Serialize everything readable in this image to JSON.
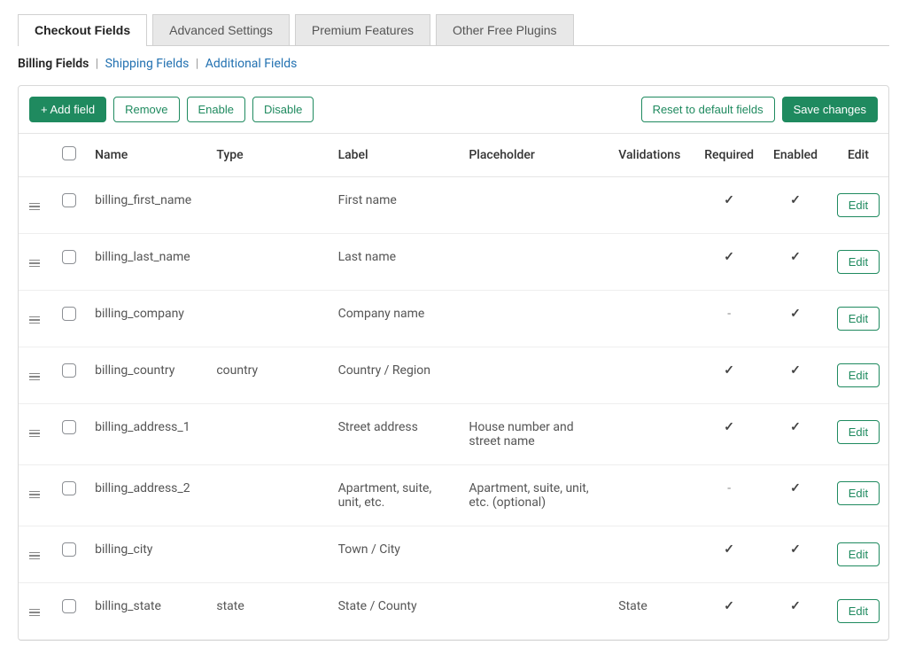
{
  "tabs": {
    "checkout_fields": "Checkout Fields",
    "advanced_settings": "Advanced Settings",
    "premium_features": "Premium Features",
    "other_free_plugins": "Other Free Plugins"
  },
  "subnav": {
    "billing": "Billing Fields",
    "shipping": "Shipping Fields",
    "additional": "Additional Fields"
  },
  "toolbar": {
    "add_field": "+ Add field",
    "remove": "Remove",
    "enable": "Enable",
    "disable": "Disable",
    "reset": "Reset to default fields",
    "save": "Save changes"
  },
  "columns": {
    "name": "Name",
    "type": "Type",
    "label": "Label",
    "placeholder": "Placeholder",
    "validations": "Validations",
    "required": "Required",
    "enabled": "Enabled",
    "edit": "Edit"
  },
  "rows": [
    {
      "name": "billing_first_name",
      "type": "",
      "label": "First name",
      "placeholder": "",
      "validations": "",
      "required": true,
      "enabled": true
    },
    {
      "name": "billing_last_name",
      "type": "",
      "label": "Last name",
      "placeholder": "",
      "validations": "",
      "required": true,
      "enabled": true
    },
    {
      "name": "billing_company",
      "type": "",
      "label": "Company name",
      "placeholder": "",
      "validations": "",
      "required": false,
      "enabled": true
    },
    {
      "name": "billing_country",
      "type": "country",
      "label": "Country / Region",
      "placeholder": "",
      "validations": "",
      "required": true,
      "enabled": true
    },
    {
      "name": "billing_address_1",
      "type": "",
      "label": "Street address",
      "placeholder": "House number and street name",
      "validations": "",
      "required": true,
      "enabled": true
    },
    {
      "name": "billing_address_2",
      "type": "",
      "label": "Apartment, suite, unit, etc.",
      "placeholder": "Apartment, suite, unit, etc. (optional)",
      "validations": "",
      "required": false,
      "enabled": true
    },
    {
      "name": "billing_city",
      "type": "",
      "label": "Town / City",
      "placeholder": "",
      "validations": "",
      "required": true,
      "enabled": true
    },
    {
      "name": "billing_state",
      "type": "state",
      "label": "State / County",
      "placeholder": "",
      "validations": "State",
      "required": true,
      "enabled": true
    }
  ],
  "edit_label": "Edit",
  "marks": {
    "check": "✓",
    "dash": "-"
  }
}
